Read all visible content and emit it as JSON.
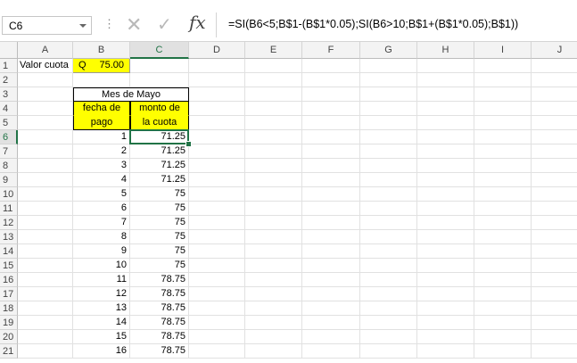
{
  "name_box": "C6",
  "formula": "=SI(B6<5;B$1-(B$1*0.05);SI(B6>10;B$1+(B$1*0.05);B$1))",
  "fx_label": "fx",
  "columns": [
    "A",
    "B",
    "C",
    "D",
    "E",
    "F",
    "G",
    "H",
    "I",
    "J"
  ],
  "rows": [
    "1",
    "2",
    "3",
    "4",
    "5",
    "6",
    "7",
    "8",
    "9",
    "10",
    "11",
    "12",
    "13",
    "14",
    "15",
    "16",
    "17",
    "18",
    "19",
    "20",
    "21"
  ],
  "a1": "Valor cuota",
  "b1_currency": "Q",
  "b1_value": "75.00",
  "b3": "Mes de Mayo",
  "b4": "fecha de",
  "b5": "pago",
  "c4": "monto de",
  "c5": "la cuota",
  "data_rows": [
    {
      "b": "1",
      "c": "71.25"
    },
    {
      "b": "2",
      "c": "71.25"
    },
    {
      "b": "3",
      "c": "71.25"
    },
    {
      "b": "4",
      "c": "71.25"
    },
    {
      "b": "5",
      "c": "75"
    },
    {
      "b": "6",
      "c": "75"
    },
    {
      "b": "7",
      "c": "75"
    },
    {
      "b": "8",
      "c": "75"
    },
    {
      "b": "9",
      "c": "75"
    },
    {
      "b": "10",
      "c": "75"
    },
    {
      "b": "11",
      "c": "78.75"
    },
    {
      "b": "12",
      "c": "78.75"
    },
    {
      "b": "13",
      "c": "78.75"
    },
    {
      "b": "14",
      "c": "78.75"
    },
    {
      "b": "15",
      "c": "78.75"
    },
    {
      "b": "16",
      "c": "78.75"
    }
  ],
  "colors": {
    "accent": "#217346",
    "highlight": "#ffff00"
  }
}
